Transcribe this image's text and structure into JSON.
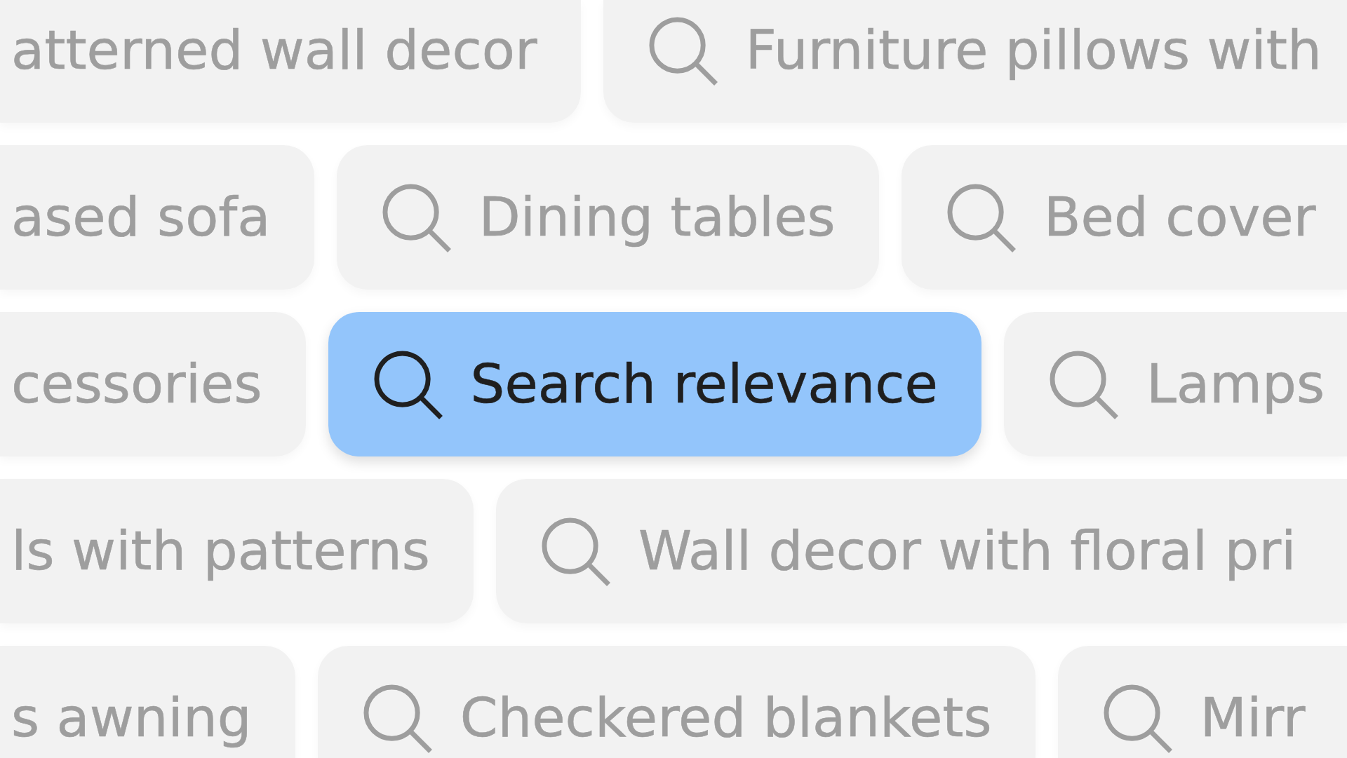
{
  "rows": [
    {
      "chips": [
        {
          "label": "atterned wall decor",
          "icon": false,
          "selected": false
        },
        {
          "label": "Furniture pillows with",
          "icon": true,
          "selected": false
        }
      ]
    },
    {
      "chips": [
        {
          "label": "ased sofa",
          "icon": false,
          "selected": false
        },
        {
          "label": "Dining tables",
          "icon": true,
          "selected": false
        },
        {
          "label": "Bed cover",
          "icon": true,
          "selected": false
        }
      ]
    },
    {
      "chips": [
        {
          "label": "cessories",
          "icon": false,
          "selected": false
        },
        {
          "label": "Search relevance",
          "icon": true,
          "selected": true
        },
        {
          "label": "Lamps",
          "icon": true,
          "selected": false
        }
      ]
    },
    {
      "chips": [
        {
          "label": "ls with patterns",
          "icon": false,
          "selected": false
        },
        {
          "label": "Wall decor with floral pri",
          "icon": true,
          "selected": false
        }
      ]
    },
    {
      "chips": [
        {
          "label": "s awning",
          "icon": false,
          "selected": false
        },
        {
          "label": "Checkered blankets",
          "icon": true,
          "selected": false
        },
        {
          "label": "Mirr",
          "icon": true,
          "selected": false
        }
      ]
    }
  ]
}
